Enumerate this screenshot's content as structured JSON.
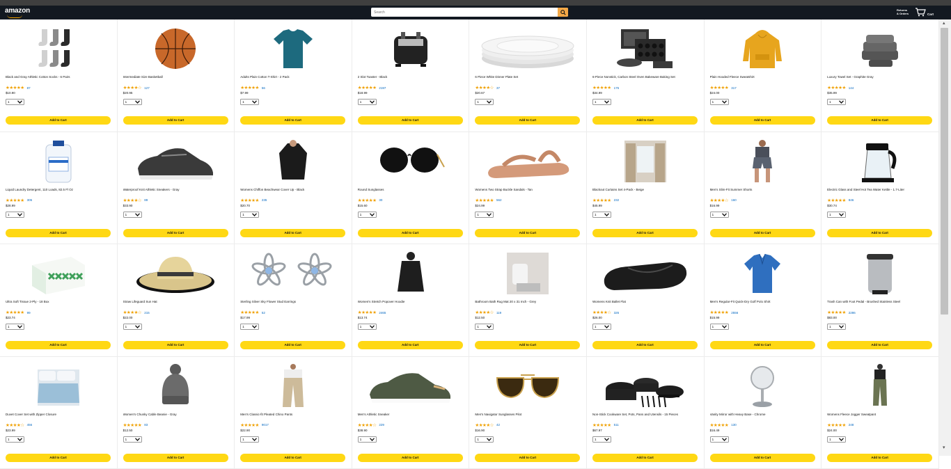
{
  "header": {
    "logo_text": "amazon",
    "search_placeholder": "Search",
    "returns_line1": "Returns",
    "returns_line2": "& Orders",
    "cart_label": "Cart"
  },
  "common": {
    "add_to_cart": "Add to Cart",
    "qty_value": "1"
  },
  "products": [
    {
      "title": "Black and Gray Athletic Cotton Socks - 6 Pairs",
      "rating_count": "87",
      "price": "$10.90",
      "icon": "socks-image",
      "rating": 4.5
    },
    {
      "title": "Intermediate Size Basketball",
      "rating_count": "127",
      "price": "$20.95",
      "icon": "basketball-image",
      "rating": 4.0
    },
    {
      "title": "Adults Plain Cotton T-Shirt - 2 Pack",
      "rating_count": "56",
      "price": "$7.99",
      "icon": "tshirt-image",
      "rating": 4.5
    },
    {
      "title": "2 Slot Toaster - Black",
      "rating_count": "2197",
      "price": "$18.99",
      "icon": "toaster-image",
      "rating": 5.0
    },
    {
      "title": "6 Piece White Dinner Plate Set",
      "rating_count": "37",
      "price": "$20.67",
      "icon": "plates-image",
      "rating": 4.0
    },
    {
      "title": "6-Piece Nonstick, Carbon Steel Oven Bakeware Baking Set",
      "rating_count": "175",
      "price": "$34.99",
      "icon": "bakeware-image",
      "rating": 4.5
    },
    {
      "title": "Plain Hooded Fleece Sweatshirt",
      "rating_count": "317",
      "price": "$24.00",
      "icon": "hoodie-image",
      "rating": 4.5
    },
    {
      "title": "Luxury Towel Set - Graphite Gray",
      "rating_count": "144",
      "price": "$35.99",
      "icon": "towels-image",
      "rating": 4.5
    },
    {
      "title": "Liquid Laundry Detergent, 110 Loads, 82.5 Fl Oz",
      "rating_count": "305",
      "price": "$28.99",
      "icon": "detergent-image",
      "rating": 4.5
    },
    {
      "title": "Waterproof Knit Athletic Sneakers - Gray",
      "rating_count": "89",
      "price": "$33.90",
      "icon": "sneaker-image",
      "rating": 4.0
    },
    {
      "title": "Womens Chiffon Beachwear Cover Up - Black",
      "rating_count": "235",
      "price": "$20.70",
      "icon": "coverup-image",
      "rating": 4.5
    },
    {
      "title": "Round Sunglasses",
      "rating_count": "30",
      "price": "$15.60",
      "icon": "sunglasses-image",
      "rating": 4.5
    },
    {
      "title": "Womens Two Strap Buckle Sandals - Tan",
      "rating_count": "562",
      "price": "$24.99",
      "icon": "sandal-image",
      "rating": 4.5
    },
    {
      "title": "Blackout Curtains Set 4-Pack - Beige",
      "rating_count": "232",
      "price": "$45.99",
      "icon": "curtains-image",
      "rating": 4.5
    },
    {
      "title": "Men's Slim-Fit Summer Shorts",
      "rating_count": "160",
      "price": "$16.99",
      "icon": "shorts-image",
      "rating": 4.0
    },
    {
      "title": "Electric Glass and Steel Hot Tea Water Kettle - 1.7-Liter",
      "rating_count": "846",
      "price": "$30.74",
      "icon": "kettle-image",
      "rating": 4.5
    },
    {
      "title": "Ultra Soft Tissue 2-Ply - 18 Box",
      "rating_count": "99",
      "price": "$23.74",
      "icon": "tissue-image",
      "rating": 4.5
    },
    {
      "title": "Straw Lifeguard Sun Hat",
      "rating_count": "215",
      "price": "$22.00",
      "icon": "sunhat-image",
      "rating": 4.0
    },
    {
      "title": "Sterling Silver Sky Flower Stud Earrings",
      "rating_count": "52",
      "price": "$17.99",
      "icon": "earrings-image",
      "rating": 4.5
    },
    {
      "title": "Women's Stretch Popover Hoodie",
      "rating_count": "2465",
      "price": "$13.74",
      "icon": "hoodie-women-image",
      "rating": 4.5
    },
    {
      "title": "Bathroom Bath Rug Mat 20 x 31 Inch - Grey",
      "rating_count": "119",
      "price": "$12.50",
      "icon": "bathmat-image",
      "rating": 4.0
    },
    {
      "title": "Womens Knit Ballet Flat",
      "rating_count": "326",
      "price": "$26.00",
      "icon": "ballet-flat-image",
      "rating": 4.0
    },
    {
      "title": "Men's Regular-Fit Quick-Dry Golf Polo Shirt",
      "rating_count": "2556",
      "price": "$15.99",
      "icon": "polo-image",
      "rating": 4.5
    },
    {
      "title": "Trash Can with Foot Pedal - Brushed Stainless Steel",
      "rating_count": "2286",
      "price": "$83.00",
      "icon": "trashcan-image",
      "rating": 4.5
    },
    {
      "title": "Duvet Cover Set with Zipper Closure",
      "rating_count": "456",
      "price": "$23.99",
      "icon": "duvet-image",
      "rating": 4.0
    },
    {
      "title": "Women's Chunky Cable Beanie - Gray",
      "rating_count": "83",
      "price": "$12.50",
      "icon": "beanie-image",
      "rating": 5.0
    },
    {
      "title": "Men's Classic-fit Pleated Chino Pants",
      "rating_count": "9017",
      "price": "$22.90",
      "icon": "chinos-image",
      "rating": 4.5
    },
    {
      "title": "Men's Athletic Sneaker",
      "rating_count": "229",
      "price": "$38.90",
      "icon": "athletic-sneaker-image",
      "rating": 4.0
    },
    {
      "title": "Men's Navigator Sunglasses Pilot",
      "rating_count": "42",
      "price": "$16.90",
      "icon": "aviator-image",
      "rating": 3.5
    },
    {
      "title": "Non-Stick Cookware Set, Pots, Pans and Utensils - 15 Pieces",
      "rating_count": "511",
      "price": "$67.97",
      "icon": "cookware-image",
      "rating": 4.5
    },
    {
      "title": "Vanity Mirror with Heavy Base - Chrome",
      "rating_count": "130",
      "price": "$16.49",
      "icon": "mirror-image",
      "rating": 4.5
    },
    {
      "title": "Womens Fleece Jogger Sweatpant",
      "rating_count": "248",
      "price": "$24.00",
      "icon": "joggers-image",
      "rating": 4.5
    }
  ]
}
